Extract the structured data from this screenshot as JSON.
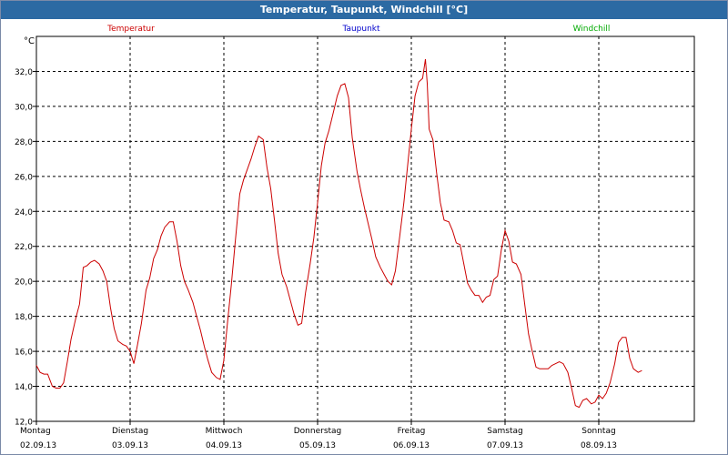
{
  "window": {
    "title": "Temperatur, Taupunkt, Windchill [°C]"
  },
  "colors": {
    "titlebar": "#2c6aa3",
    "temperatur": "#cc0000",
    "taupunkt": "#0000cc",
    "windchill": "#00aa00",
    "grid": "#000000"
  },
  "chart_data": {
    "type": "line",
    "title": "Temperatur, Taupunkt, Windchill [°C]",
    "ylabel": "°C",
    "ylim": [
      12,
      34
    ],
    "ytick_values": [
      12,
      14,
      16,
      18,
      20,
      22,
      24,
      26,
      28,
      30,
      32
    ],
    "ytick_labels": [
      "12,0",
      "14,0",
      "16,0",
      "18,0",
      "20,0",
      "22,0",
      "24,0",
      "26,0",
      "28,0",
      "30,0",
      "32,0"
    ],
    "xlim": [
      0,
      7
    ],
    "x_ticks": [
      {
        "day": "Montag",
        "date": "02.09.13",
        "x": 0
      },
      {
        "day": "Dienstag",
        "date": "03.09.13",
        "x": 1
      },
      {
        "day": "Mittwoch",
        "date": "04.09.13",
        "x": 2
      },
      {
        "day": "Donnerstag",
        "date": "05.09.13",
        "x": 3
      },
      {
        "day": "Freitag",
        "date": "06.09.13",
        "x": 4
      },
      {
        "day": "Samstag",
        "date": "07.09.13",
        "x": 5
      },
      {
        "day": "Sonntag",
        "date": "08.09.13",
        "x": 6
      }
    ],
    "legend": [
      "Temperatur",
      "Taupunkt",
      "Windchill"
    ],
    "legend_placement": "top",
    "grid": true,
    "series": [
      {
        "name": "Temperatur",
        "color": "#cc0000",
        "points": [
          [
            0.0,
            15.2
          ],
          [
            0.04,
            14.8
          ],
          [
            0.08,
            14.7
          ],
          [
            0.12,
            14.7
          ],
          [
            0.17,
            14.0
          ],
          [
            0.21,
            13.9
          ],
          [
            0.25,
            13.9
          ],
          [
            0.29,
            14.2
          ],
          [
            0.33,
            15.4
          ],
          [
            0.37,
            16.7
          ],
          [
            0.42,
            17.9
          ],
          [
            0.46,
            18.7
          ],
          [
            0.5,
            20.8
          ],
          [
            0.54,
            20.9
          ],
          [
            0.58,
            21.1
          ],
          [
            0.62,
            21.2
          ],
          [
            0.67,
            21.0
          ],
          [
            0.71,
            20.6
          ],
          [
            0.75,
            20.0
          ],
          [
            0.79,
            18.5
          ],
          [
            0.83,
            17.3
          ],
          [
            0.87,
            16.6
          ],
          [
            0.92,
            16.4
          ],
          [
            0.96,
            16.3
          ],
          [
            1.0,
            16.0
          ],
          [
            1.04,
            15.3
          ],
          [
            1.08,
            16.4
          ],
          [
            1.12,
            17.6
          ],
          [
            1.17,
            19.5
          ],
          [
            1.21,
            20.2
          ],
          [
            1.25,
            21.3
          ],
          [
            1.29,
            21.8
          ],
          [
            1.33,
            22.6
          ],
          [
            1.37,
            23.1
          ],
          [
            1.42,
            23.4
          ],
          [
            1.46,
            23.4
          ],
          [
            1.5,
            22.3
          ],
          [
            1.54,
            20.9
          ],
          [
            1.58,
            20.0
          ],
          [
            1.62,
            19.5
          ],
          [
            1.67,
            18.8
          ],
          [
            1.71,
            18.0
          ],
          [
            1.75,
            17.2
          ],
          [
            1.79,
            16.3
          ],
          [
            1.83,
            15.5
          ],
          [
            1.87,
            14.8
          ],
          [
            1.92,
            14.5
          ],
          [
            1.96,
            14.4
          ],
          [
            2.0,
            15.5
          ],
          [
            2.04,
            17.7
          ],
          [
            2.08,
            19.8
          ],
          [
            2.12,
            22.2
          ],
          [
            2.17,
            25.0
          ],
          [
            2.21,
            25.8
          ],
          [
            2.25,
            26.4
          ],
          [
            2.29,
            27.0
          ],
          [
            2.33,
            27.7
          ],
          [
            2.37,
            28.3
          ],
          [
            2.42,
            28.1
          ],
          [
            2.46,
            26.5
          ],
          [
            2.5,
            25.3
          ],
          [
            2.54,
            23.5
          ],
          [
            2.58,
            21.6
          ],
          [
            2.62,
            20.4
          ],
          [
            2.67,
            19.7
          ],
          [
            2.71,
            18.9
          ],
          [
            2.75,
            18.1
          ],
          [
            2.79,
            17.5
          ],
          [
            2.83,
            17.6
          ],
          [
            2.87,
            19.3
          ],
          [
            2.92,
            21.0
          ],
          [
            2.96,
            22.5
          ],
          [
            3.0,
            24.5
          ],
          [
            3.04,
            26.6
          ],
          [
            3.08,
            27.9
          ],
          [
            3.12,
            28.6
          ],
          [
            3.17,
            29.7
          ],
          [
            3.21,
            30.6
          ],
          [
            3.25,
            31.2
          ],
          [
            3.29,
            31.3
          ],
          [
            3.33,
            30.5
          ],
          [
            3.37,
            28.2
          ],
          [
            3.42,
            26.3
          ],
          [
            3.46,
            25.2
          ],
          [
            3.5,
            24.2
          ],
          [
            3.54,
            23.3
          ],
          [
            3.58,
            22.4
          ],
          [
            3.62,
            21.4
          ],
          [
            3.67,
            20.8
          ],
          [
            3.71,
            20.4
          ],
          [
            3.75,
            20.0
          ],
          [
            3.79,
            19.8
          ],
          [
            3.83,
            20.6
          ],
          [
            3.87,
            22.3
          ],
          [
            3.92,
            24.5
          ],
          [
            3.96,
            26.6
          ],
          [
            4.0,
            28.7
          ],
          [
            4.04,
            30.6
          ],
          [
            4.08,
            31.4
          ],
          [
            4.12,
            31.6
          ],
          [
            4.15,
            32.7
          ],
          [
            4.17,
            31.3
          ],
          [
            4.19,
            28.7
          ],
          [
            4.23,
            28.1
          ],
          [
            4.27,
            26.2
          ],
          [
            4.31,
            24.5
          ],
          [
            4.35,
            23.5
          ],
          [
            4.4,
            23.4
          ],
          [
            4.44,
            22.9
          ],
          [
            4.48,
            22.2
          ],
          [
            4.52,
            22.1
          ],
          [
            4.56,
            21.0
          ],
          [
            4.6,
            19.9
          ],
          [
            4.64,
            19.5
          ],
          [
            4.68,
            19.2
          ],
          [
            4.72,
            19.2
          ],
          [
            4.76,
            18.8
          ],
          [
            4.8,
            19.1
          ],
          [
            4.84,
            19.2
          ],
          [
            4.88,
            20.1
          ],
          [
            4.92,
            20.3
          ],
          [
            4.96,
            21.8
          ],
          [
            5.0,
            22.9
          ],
          [
            5.04,
            22.3
          ],
          [
            5.08,
            21.1
          ],
          [
            5.12,
            21.0
          ],
          [
            5.17,
            20.4
          ],
          [
            5.21,
            18.7
          ],
          [
            5.25,
            17.0
          ],
          [
            5.29,
            16.0
          ],
          [
            5.33,
            15.1
          ],
          [
            5.37,
            15.0
          ],
          [
            5.42,
            15.0
          ],
          [
            5.46,
            15.0
          ],
          [
            5.5,
            15.2
          ],
          [
            5.54,
            15.3
          ],
          [
            5.58,
            15.4
          ],
          [
            5.62,
            15.3
          ],
          [
            5.67,
            14.8
          ],
          [
            5.71,
            13.9
          ],
          [
            5.75,
            12.9
          ],
          [
            5.79,
            12.8
          ],
          [
            5.83,
            13.2
          ],
          [
            5.87,
            13.3
          ],
          [
            5.92,
            13.0
          ],
          [
            5.96,
            13.1
          ],
          [
            6.0,
            13.5
          ],
          [
            6.04,
            13.3
          ],
          [
            6.08,
            13.6
          ],
          [
            6.12,
            14.2
          ],
          [
            6.17,
            15.3
          ],
          [
            6.21,
            16.5
          ],
          [
            6.25,
            16.8
          ],
          [
            6.29,
            16.8
          ],
          [
            6.33,
            15.6
          ],
          [
            6.37,
            15.0
          ],
          [
            6.42,
            14.8
          ],
          [
            6.46,
            14.9
          ]
        ]
      },
      {
        "name": "Taupunkt",
        "color": "#0000cc",
        "points": []
      },
      {
        "name": "Windchill",
        "color": "#00aa00",
        "points": []
      }
    ]
  }
}
